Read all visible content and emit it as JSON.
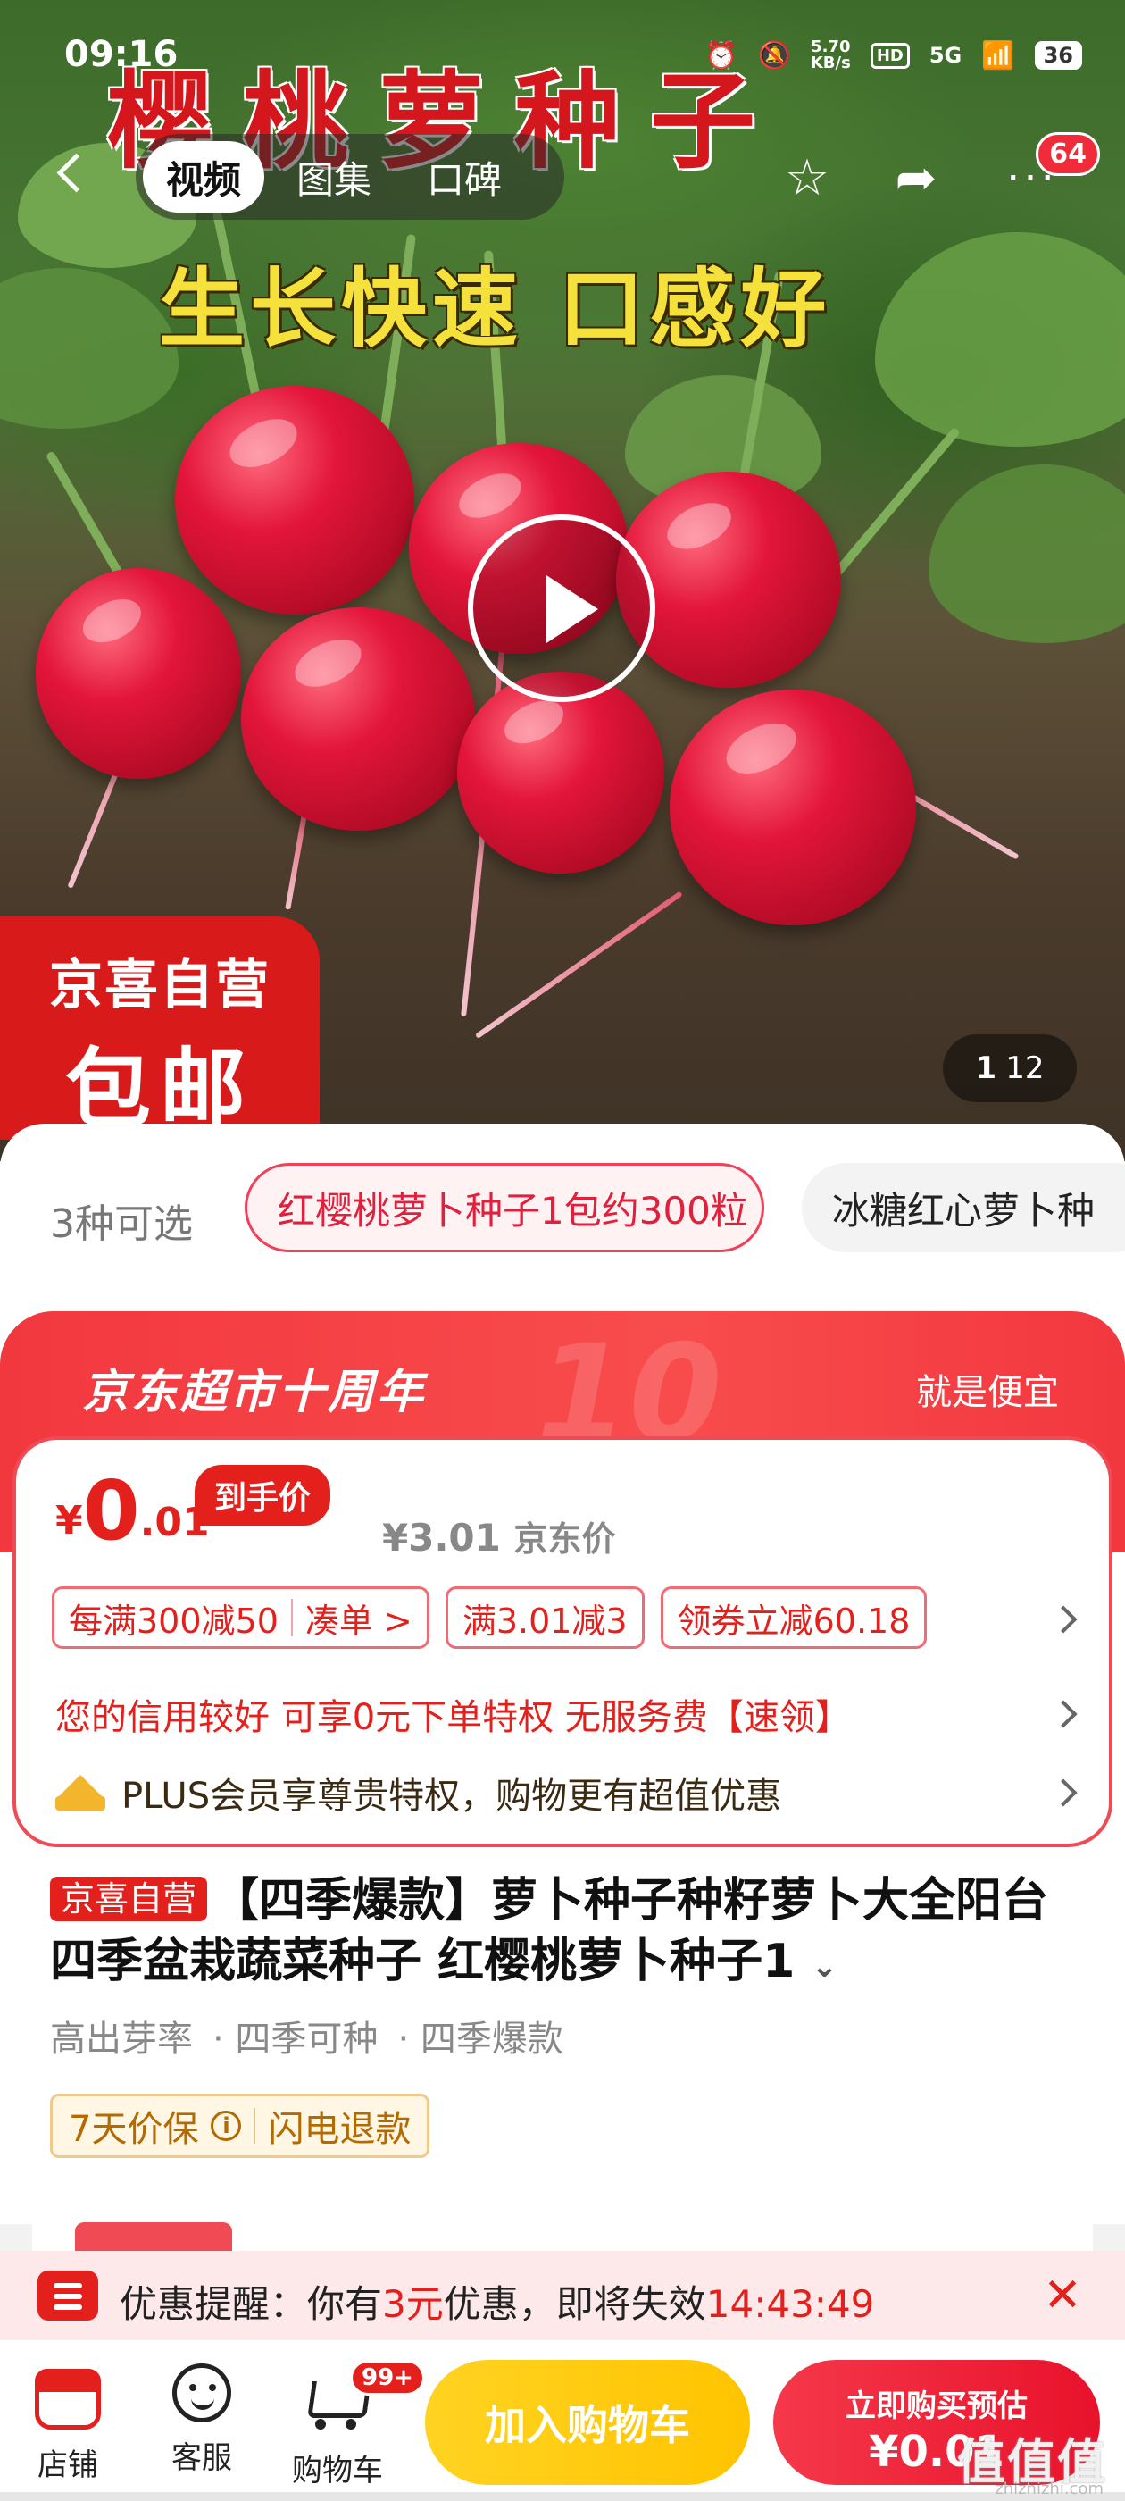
{
  "status_bar": {
    "time": "09:16",
    "net_speed": "5.70",
    "net_unit": "KB/s",
    "hd": "HD",
    "signal": "5G",
    "battery": "36"
  },
  "hero": {
    "overlay_title": "樱桃萝种子",
    "overlay_subtitle": "生长快速 口感好",
    "tabs": [
      "视频",
      "图集",
      "口碑"
    ],
    "active_tab": 0,
    "more_badge": "64",
    "promo_line1": "京喜自营",
    "promo_line2": "包邮",
    "image_index": "1",
    "image_total": "12"
  },
  "variants": {
    "count_label": "3种可选",
    "options": [
      "红樱桃萝卜种子1包约300粒",
      "冰糖红心萝卜种"
    ]
  },
  "promo_banner": {
    "title": "京东超市十周年",
    "right_text": "就是便宜"
  },
  "price": {
    "currency": "¥",
    "integer": "0",
    "decimal": ".01",
    "final_tag": "到手价",
    "jd_price": "¥3.01",
    "jd_price_label": "京东价"
  },
  "coupons": {
    "c1_main": "每满300减50",
    "c1_action": "凑单 >",
    "c2": "满3.01减3",
    "c3": "领券立减60.18"
  },
  "credit_text": "您的信用较好 可享0元下单特权 无服务费【速领】",
  "plus_text": "PLUS会员享尊贵特权，购物更有超值优惠",
  "product": {
    "self_tag": "京喜自营",
    "title": "【四季爆款】萝卜种子种籽萝卜大全阳台四季盆栽蔬菜种子 红樱桃萝卜种子1",
    "features": [
      "高出芽率",
      "· 四季可种",
      "· 四季爆款"
    ],
    "guarantee_1": "7天价保",
    "guarantee_info": "i",
    "guarantee_2": "闪电退款"
  },
  "reminder": {
    "prefix": "优惠提醒：你有",
    "amount": "3元",
    "middle": "优惠，即将失效",
    "countdown": "14:43:49",
    "close": "✕"
  },
  "bottom_bar": {
    "shop": "店铺",
    "service": "客服",
    "cart": "购物车",
    "cart_badge": "99+",
    "add_to_cart": "加入购物车",
    "buy_line1": "立即购买预估",
    "buy_line2": "¥0.01"
  },
  "watermark": {
    "main": "值值值",
    "sub": "zhizhizhi.com"
  },
  "colors": {
    "brand_red": "#e4201d",
    "cart_yellow": "#ffc400"
  }
}
